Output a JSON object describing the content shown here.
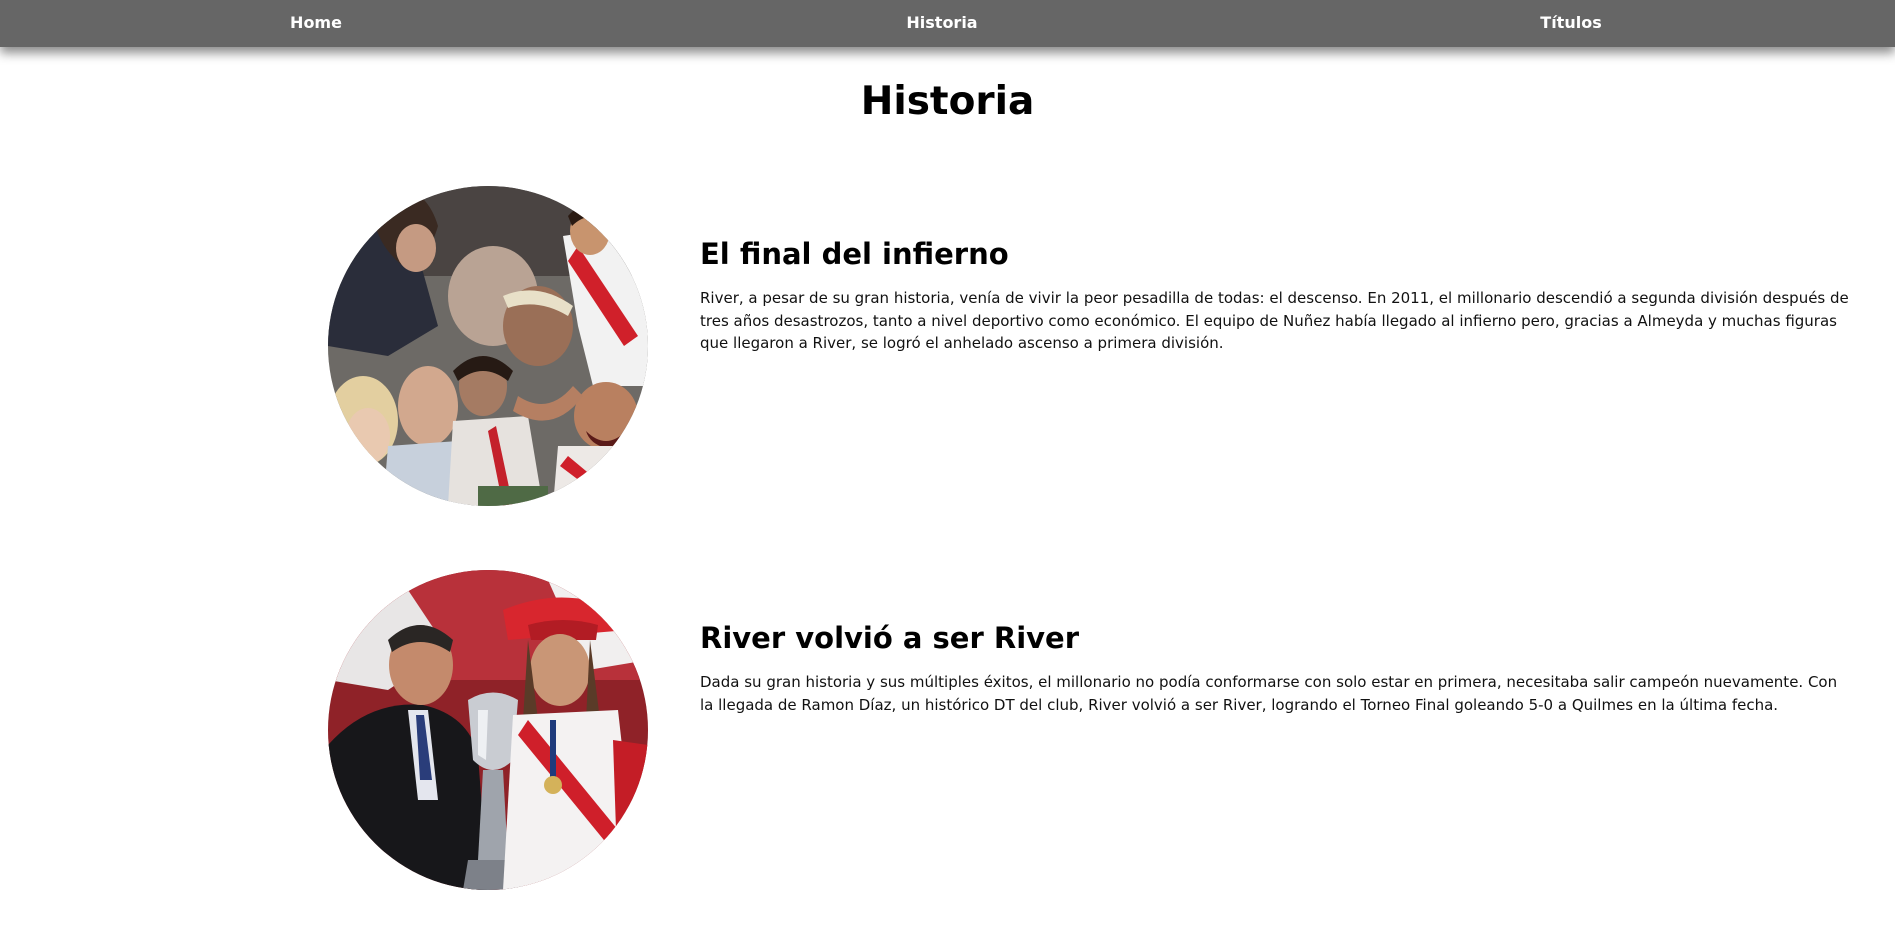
{
  "nav": {
    "home": "Home",
    "historia": "Historia",
    "titulos": "Títulos"
  },
  "page": {
    "title": "Historia"
  },
  "sections": [
    {
      "heading": "El final del infierno",
      "text": "River, a pesar de su gran historia, venía de vivir la peor pesadilla de todas: el descenso. En 2011, el millonario descendió a segunda división después de tres años desastrozos, tanto a nivel deportivo como económico. El equipo de Nuñez había llegado al infierno pero, gracias a Almeyda y muchas figuras que llegaron a River, se logró el anhelado ascenso a primera división."
    },
    {
      "heading": "River volvió a ser River",
      "text": "Dada su gran historia y sus múltiples éxitos, el millonario no podía conformarse con solo estar en primera, necesitaba salir campeón nuevamente. Con la llegada de Ramon Díaz, un histórico DT del club, River volvió a ser River, logrando el Torneo Final goleando 5-0 a Quilmes en la última fecha."
    }
  ]
}
